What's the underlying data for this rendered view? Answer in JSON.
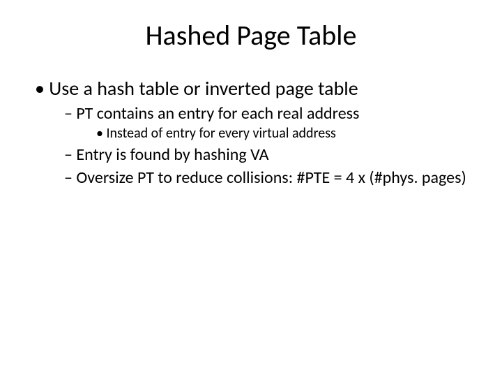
{
  "title": "Hashed Page Table",
  "bullets": {
    "l1_0": "Use a hash table or inverted page table",
    "l2_0": "PT contains an entry for each real address",
    "l3_0": "Instead of entry for every virtual address",
    "l2_1": "Entry is found by hashing VA",
    "l2_2": "Oversize PT to reduce collisions: #PTE = 4 x (#phys. pages)"
  }
}
